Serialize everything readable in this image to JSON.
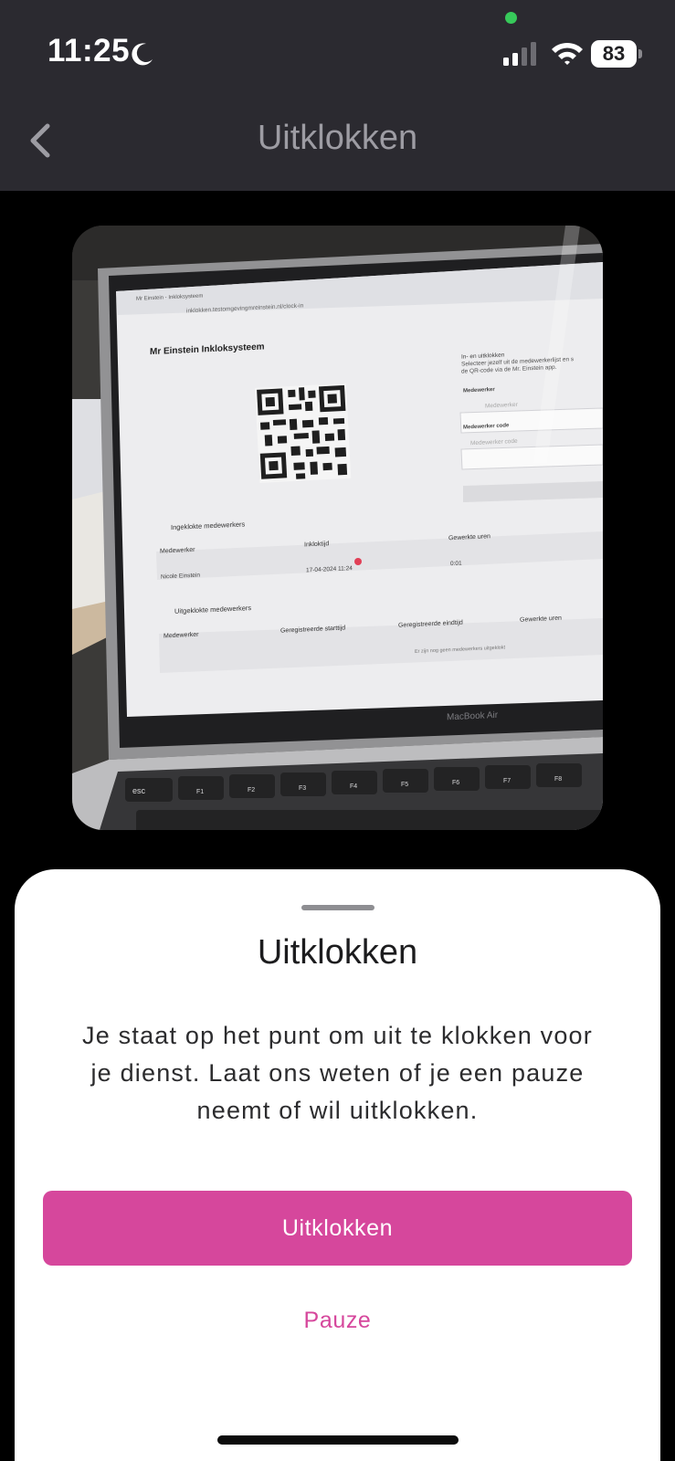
{
  "status_bar": {
    "time": "11:25",
    "battery": "83",
    "icons": [
      "moon-icon",
      "signal-icon",
      "wifi-icon",
      "battery-icon"
    ]
  },
  "nav": {
    "title": "Uitklokken",
    "back_icon": "chevron-left-icon"
  },
  "camera": {
    "screen": {
      "app_title": "Mr Einstein Inkloksysteem",
      "tab_title": "Mr Einstein - Inkloksysteem",
      "url": "inklokken.testomgevingmreinstein.nl/clock-in",
      "side_heading": "In- en uitklokken",
      "side_text_1": "Selecteer jezelf uit de medewerkerlijst en s",
      "side_text_2": "de QR-code via de Mr. Einstein app.",
      "field1_label": "Medewerker",
      "field1_placeholder": "Medewerker",
      "field2_label": "Medewerker code",
      "field2_placeholder": "Medewerker code",
      "clocked_in_heading": "Ingeklokte medewerkers",
      "clocked_in_cols": [
        "Medewerker",
        "Inkloktijd",
        "Gewerkte uren"
      ],
      "clocked_in_row": [
        "Nicole Einstein",
        "17-04-2024 11:24",
        "0:01"
      ],
      "clocked_out_heading": "Uitgeklokte medewerkers",
      "clocked_out_cols": [
        "Medewerker",
        "Geregistreerde starttijd",
        "Geregistreerde eindtijd",
        "Gewerkte uren"
      ],
      "clocked_out_empty": "Er zijn nog geen medewerkers uitgeklokt",
      "laptop_label": "MacBook Air",
      "keys": [
        "esc",
        "F1",
        "F2",
        "F3",
        "F4",
        "F5",
        "F6",
        "F7",
        "F8"
      ]
    }
  },
  "sheet": {
    "title": "Uitklokken",
    "message": "Je staat op het punt om uit te klokken voor je dienst. Laat ons weten of je een pauze neemt of wil uitklokken.",
    "primary_button": "Uitklokken",
    "secondary_button": "Pauze"
  },
  "colors": {
    "accent": "#d6479c",
    "nav_background": "#2b2a30",
    "sheet_background": "#ffffff"
  }
}
